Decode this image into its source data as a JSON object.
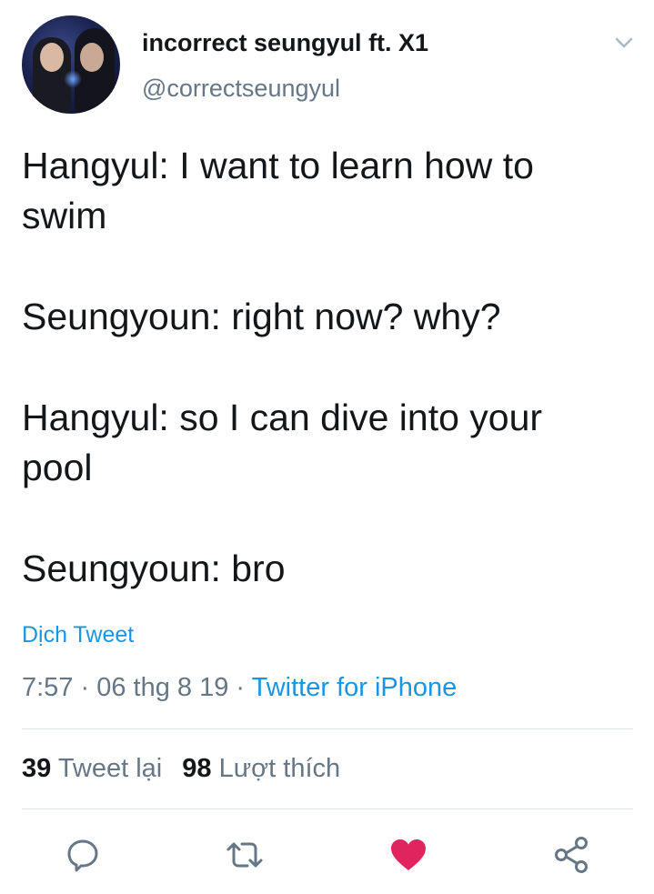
{
  "author": {
    "display_name": "incorrect seungyul ft. X1",
    "handle": "@correctseungyul"
  },
  "tweet": {
    "paragraphs": [
      "Hangyul: I want to learn how to swim",
      "Seungyoun: right now? why?",
      "Hangyul: so I can dive into your pool",
      "Seungyoun: bro"
    ]
  },
  "translate_label": "Dịch Tweet",
  "meta": {
    "time": "7:57",
    "date": "06 thg 8 19",
    "source": "Twitter for iPhone"
  },
  "stats": {
    "retweets_count": "39",
    "retweets_label": "Tweet lại",
    "likes_count": "98",
    "likes_label": "Lượt thích"
  },
  "icons": {
    "reply": "reply-icon",
    "retweet": "retweet-icon",
    "like": "heart-icon",
    "share": "share-icon",
    "menu": "chevron-down-icon"
  },
  "colors": {
    "link": "#1b95e0",
    "secondary_text": "#657786",
    "like_active": "#e0245e",
    "icon_gray": "#657786"
  }
}
